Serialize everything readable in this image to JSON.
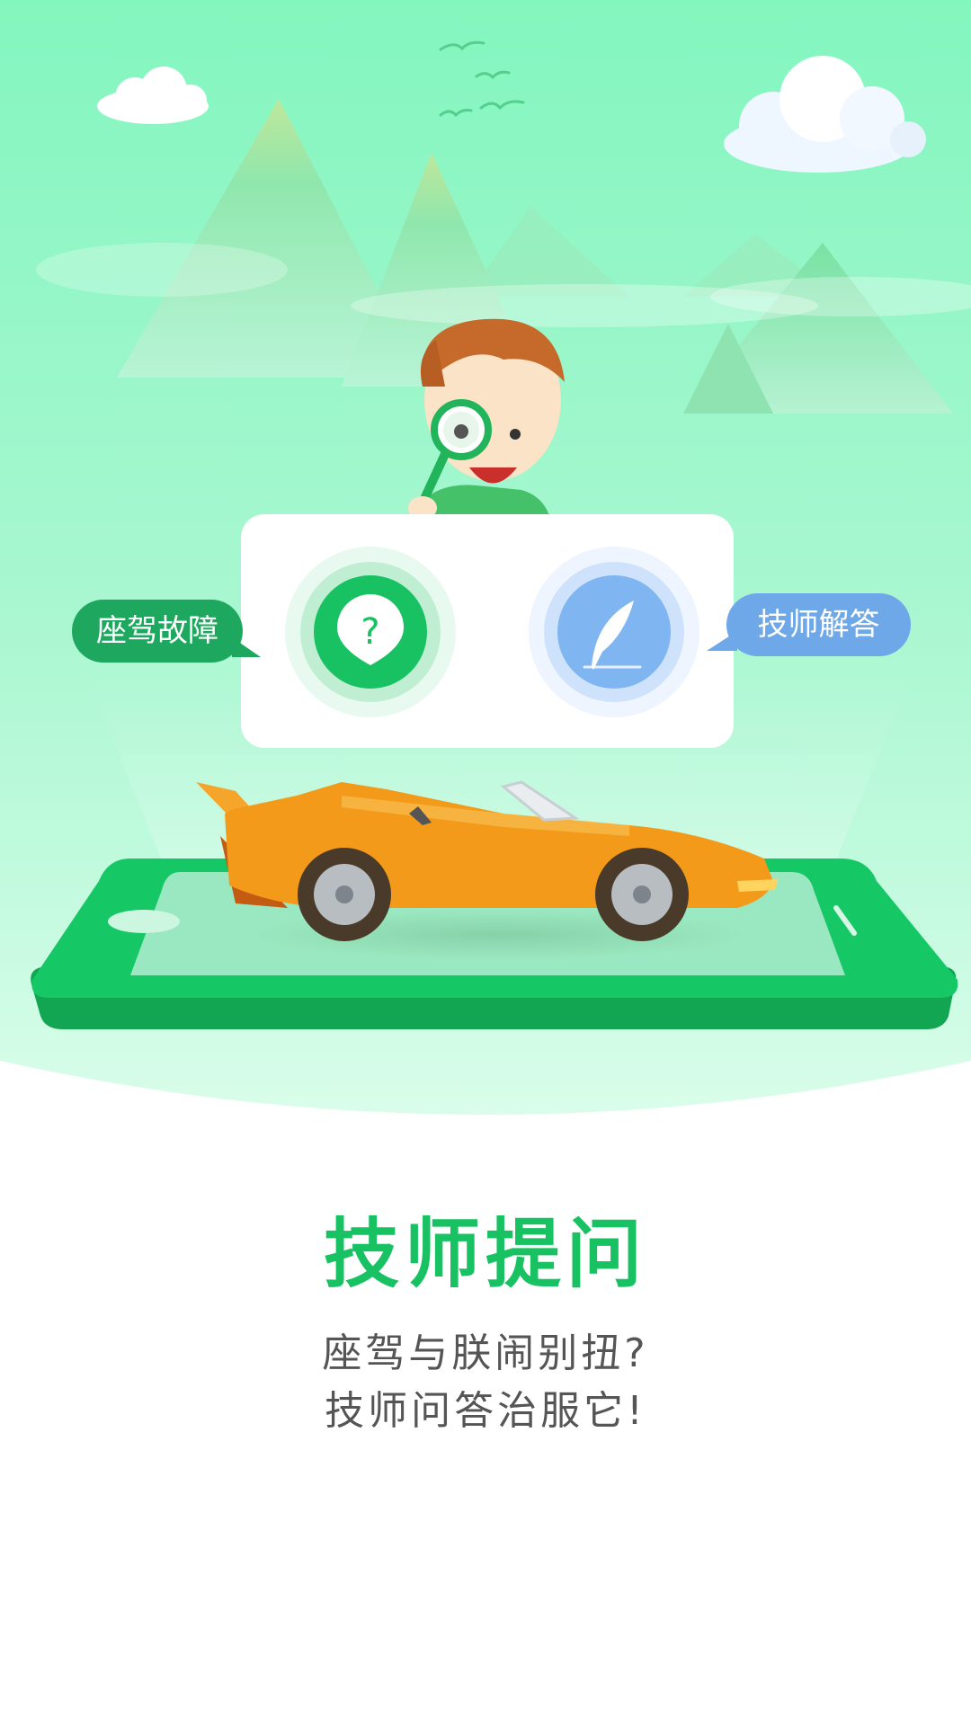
{
  "scene": {
    "left_bubble": "座驾故障",
    "right_bubble": "技师解答",
    "question_glyph": "?",
    "icons": [
      "question-pin-icon",
      "feather-icon"
    ],
    "colors": {
      "bg_top": "#86f5bf",
      "bg_mid": "#bdfadc",
      "accent_green": "#18c161",
      "accent_blue": "#78b3f3",
      "car_orange": "#f39a1a"
    }
  },
  "main": {
    "title": "技师提问",
    "subtitle_line1": "座驾与朕闹别扭?",
    "subtitle_line2": "技师问答治服它!"
  }
}
